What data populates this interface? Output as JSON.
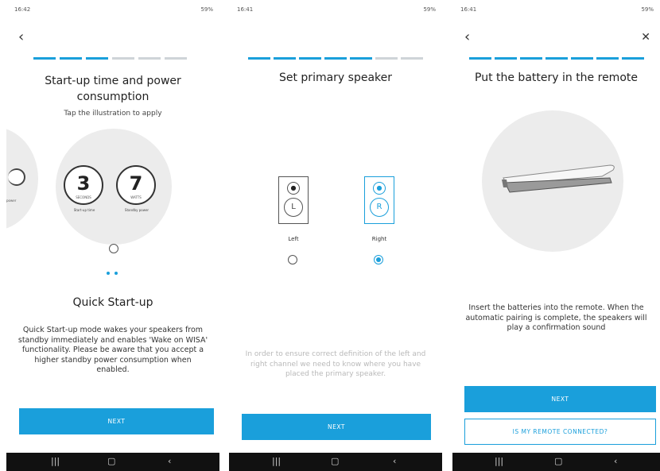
{
  "screens": [
    {
      "status": {
        "time": "16:42",
        "indicators": "59%"
      },
      "progress": {
        "filled": 3,
        "total": 6
      },
      "title": "Start-up time and power consumption",
      "subtitle": "Tap the illustration to apply",
      "illustration": {
        "left_partial_label": "power",
        "dial_startup_value": "3",
        "dial_startup_unit": "SECONDS",
        "dial_standby_value": "7",
        "dial_standby_unit": "WATTS",
        "startup_caption": "Start-up time",
        "standby_caption": "Standby power"
      },
      "pager_dots": 2,
      "option_title": "Quick Start-up",
      "description": "Quick Start-up mode wakes your speakers from standby immediately and enables 'Wake on WISA' functionality. Please be aware that you accept a higher standby power consumption when enabled.",
      "next_label": "NEXT"
    },
    {
      "status": {
        "time": "16:41",
        "indicators": "59%"
      },
      "progress": {
        "filled": 5,
        "total": 6
      },
      "title": "Set primary speaker",
      "left": {
        "symbol": "L",
        "label": "Left",
        "selected": false
      },
      "right": {
        "symbol": "R",
        "label": "Right",
        "selected": true
      },
      "hint": "In order to ensure correct definition of the left and right channel we need to know where you have placed the primary speaker.",
      "next_label": "NEXT"
    },
    {
      "status": {
        "time": "16:41",
        "indicators": "59%"
      },
      "progress": {
        "filled": 6,
        "total": 6
      },
      "title": "Put the battery in the remote",
      "description": "Insert the batteries into the remote. When the automatic pairing is complete, the speakers will play a confirmation sound",
      "next_label": "NEXT",
      "secondary_label": "IS MY REMOTE CONNECTED?"
    }
  ],
  "navbar": {
    "recents": "|||",
    "home": "▢",
    "back": "‹"
  },
  "icons": {
    "back": "chevron-left-icon",
    "close": "close-icon"
  },
  "colors": {
    "accent": "#1a9fdb",
    "navbar": "#111111",
    "progress_off": "#cfd4d8"
  }
}
